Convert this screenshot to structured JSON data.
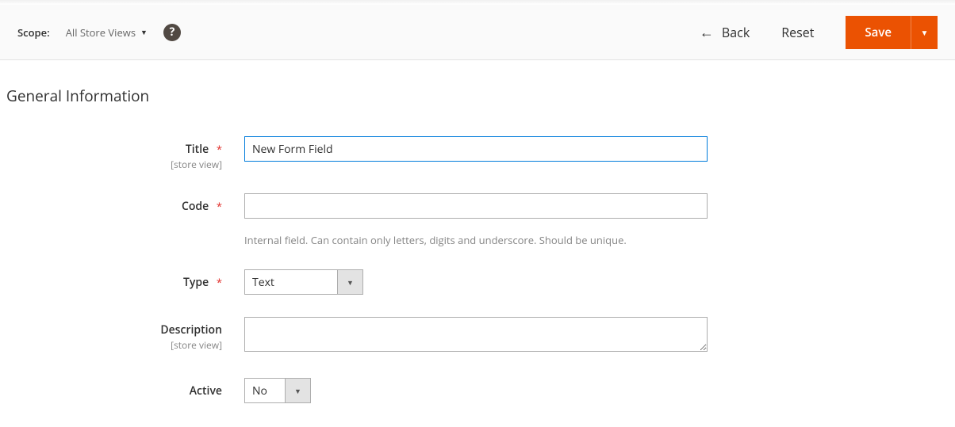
{
  "toolbar": {
    "scope_label": "Scope:",
    "scope_value": "All Store Views",
    "back_label": "Back",
    "reset_label": "Reset",
    "save_label": "Save"
  },
  "section": {
    "title": "General Information"
  },
  "fields": {
    "title": {
      "label": "Title",
      "scope": "[store view]",
      "value": "New Form Field"
    },
    "code": {
      "label": "Code",
      "value": "",
      "note": "Internal field. Can contain only letters, digits and underscore. Should be unique."
    },
    "type": {
      "label": "Type",
      "value": "Text"
    },
    "description": {
      "label": "Description",
      "scope": "[store view]",
      "value": ""
    },
    "active": {
      "label": "Active",
      "value": "No"
    }
  }
}
